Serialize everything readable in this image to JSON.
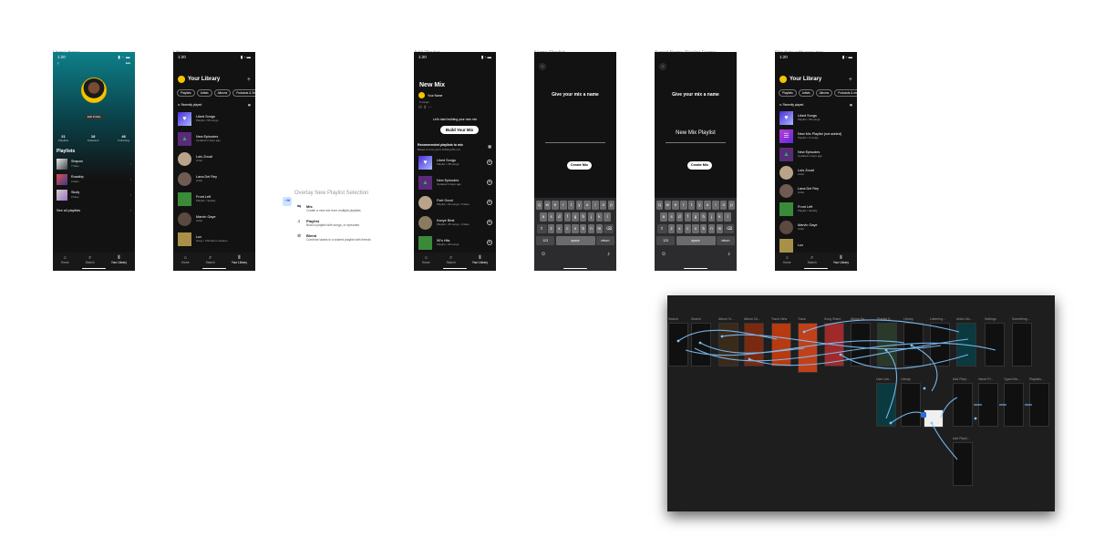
{
  "frames": {
    "user_library": {
      "label": "User Library",
      "time": "1:20",
      "edit_profile": "Edit Profile",
      "stats": [
        {
          "value": "21",
          "label": "Playlists"
        },
        {
          "value": "18",
          "label": "Followers"
        },
        {
          "value": "46",
          "label": "Following"
        }
      ],
      "playlists_title": "Playlists",
      "playlists": [
        {
          "name": "Shapow",
          "sub": "7 likes"
        },
        {
          "name": "Roadtrip",
          "sub": "0 likes"
        },
        {
          "name": "Study",
          "sub": "0 likes"
        }
      ],
      "see_all": "See all playlists"
    },
    "library": {
      "label": "Library",
      "time": "1:20",
      "title": "Your Library",
      "chips": [
        "Playlists",
        "Artists",
        "Albums",
        "Podcasts & Shows"
      ],
      "sort": "Recently played",
      "items": [
        {
          "name": "Liked Songs",
          "sub": "Playlist • 58 songs"
        },
        {
          "name": "New Episodes",
          "sub": "Updated 2 days ago"
        },
        {
          "name": "Lolo Zouaï",
          "sub": "Artist"
        },
        {
          "name": "Lana Del Rey",
          "sub": "Artist"
        },
        {
          "name": "Front Left",
          "sub": "Playlist • Spotify"
        },
        {
          "name": "Marvin Gaye",
          "sub": "Artist"
        },
        {
          "name": "Lux",
          "sub": "Song • Christian Lussiano"
        }
      ]
    },
    "add_playlist": {
      "label": "Add Playlist",
      "time": "1:20",
      "title": "New Mix",
      "owner": "Your Name",
      "owner_sub": "0 songs",
      "hint": "Let's start building your new mix",
      "build": "Build Your Mix",
      "rec_title": "Recommended playlists to mix",
      "rec_sub": "Based on how you're building this mix",
      "items": [
        {
          "name": "Liked Songs",
          "sub": "Playlist • 58 songs"
        },
        {
          "name": "New Episodes",
          "sub": "Updated 2 days ago"
        },
        {
          "name": "Feel Good",
          "sub": "Playlist • 62 songs • 5 likes"
        },
        {
          "name": "Kanye Best",
          "sub": "Playlist • 45 songs • 3 likes"
        },
        {
          "name": "90's Hits",
          "sub": "Playlist • 90 songs"
        }
      ]
    },
    "name_playlist": {
      "label": "Name Playlist",
      "time": "1:20",
      "title": "Give your mix a name",
      "value": "",
      "create": "Create Mix"
    },
    "typed_name": {
      "label": "Typed Name Playlist Frame",
      "time": "1:20",
      "title": "Give your mix a name",
      "value": "New Mix Playlist",
      "create": "Create Mix"
    },
    "with_new_mix": {
      "label": "Playlists with new mix",
      "time": "1:20",
      "title": "Your Library",
      "chips": [
        "Playlists",
        "Artists",
        "Albums",
        "Podcasts & shows"
      ],
      "sort": "Recently played",
      "items": [
        {
          "name": "Liked Songs",
          "sub": "Playlist • 58 songs"
        },
        {
          "name": "New Mix Playlist (not added)",
          "sub": "Playlist • 0 songs"
        },
        {
          "name": "New Episodes",
          "sub": "Updated 2 days ago"
        },
        {
          "name": "Lolo Zouaï",
          "sub": "Artist"
        },
        {
          "name": "Lana Del Rey",
          "sub": "Artist"
        },
        {
          "name": "Front Left",
          "sub": "Playlist • Spotify"
        },
        {
          "name": "Marvin Gaye",
          "sub": "Artist"
        },
        {
          "name": "Lux",
          "sub": ""
        }
      ]
    }
  },
  "tabs": [
    "Home",
    "Search",
    "Your Library"
  ],
  "keyboard": {
    "row1": [
      "q",
      "w",
      "e",
      "r",
      "t",
      "y",
      "u",
      "i",
      "o",
      "p"
    ],
    "row2": [
      "a",
      "s",
      "d",
      "f",
      "g",
      "h",
      "j",
      "k",
      "l"
    ],
    "row3": [
      "z",
      "x",
      "c",
      "v",
      "b",
      "n",
      "m"
    ],
    "num": "123",
    "space": "space",
    "return": "return"
  },
  "overlay": {
    "title": "Overlay New Playlist Selection",
    "options": [
      {
        "title": "Mix",
        "desc": "Create a new mix from multiple playlists"
      },
      {
        "title": "Playlist",
        "desc": "Build a playlist with songs, or episodes"
      },
      {
        "title": "Blend",
        "desc": "Combine tastes in a shared playlist with friends"
      }
    ]
  },
  "flow_labels": [
    "Search",
    "Search",
    "Album Vi...",
    "Album Cli...",
    "Track View",
    "Track",
    "Song Share",
    "Album Sa...",
    "Playlist S...",
    "Library",
    "Listening...",
    "Artist Libr...",
    "Settings",
    "Something...",
    "User Libr...",
    "Library",
    "Add Playl...",
    "Name Pl...",
    "Typed Na...",
    "Playlists...",
    "Add Playli..."
  ],
  "colors": {
    "accent": "#1db954",
    "canvas": "#1e1e1e",
    "phone_bg": "#121212",
    "flow_line": "#7fc4ff"
  }
}
